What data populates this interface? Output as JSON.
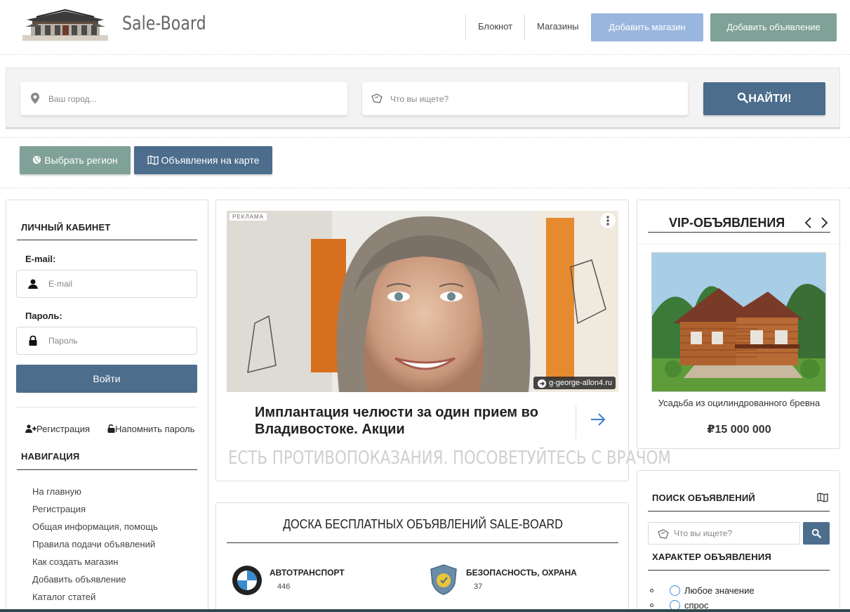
{
  "header": {
    "brand": "Sale-Board",
    "nav": [
      "Блокнот",
      "Магазины"
    ],
    "add_shop": "Добавить магазин",
    "add_ad": "Добавить объявление"
  },
  "search": {
    "city_placeholder": "Ваш город...",
    "query_placeholder": "Что вы ищете?",
    "find": "НАЙТИ!"
  },
  "subbar": {
    "region": "Выбрать регион",
    "map": "Объявления на карте"
  },
  "account": {
    "title": "ЛИЧНЫЙ КАБИНЕТ",
    "email_label": "E-mail:",
    "email_placeholder": "E-mail",
    "password_label": "Пароль:",
    "password_placeholder": "Пароль",
    "login": "Войти",
    "register": "Регистрация",
    "remind": "Напомнить пароль"
  },
  "navigation": {
    "title": "НАВИГАЦИЯ",
    "items": [
      "На главную",
      "Регистрация",
      "Общая информация, помощь",
      "Правила подачи объявлений",
      "Как создать магазин",
      "Добавить объявление",
      "Каталог статей"
    ]
  },
  "ad": {
    "tag": "РЕКЛАМА",
    "url": "g-george-allon4.ru",
    "title": "Имплантация челюсти за один прием во Владивостоке. Акции",
    "warning": "ЕСТЬ ПРОТИВОПОКАЗАНИЯ. ПОСОВЕТУЙТЕСЬ С ВРАЧОМ"
  },
  "board": {
    "title": "ДОСКА БЕСПЛАТНЫХ ОБЪЯВЛЕНИЙ SALE-BOARD",
    "categories": [
      {
        "name": "АВТОТРАНСПОРТ",
        "count": "446"
      },
      {
        "name": "БЕЗОПАСНОСТЬ, ОХРАНА",
        "count": "37"
      }
    ]
  },
  "vip": {
    "title": "VIP-ОБЪЯВЛЕНИЯ",
    "item_title": "Усадьба из оцилиндрованного бревна",
    "item_price": "₽15 000 000"
  },
  "ad_search": {
    "title": "ПОИСК ОБЪЯВЛЕНИЙ",
    "placeholder": "Что вы ищете?",
    "character_title": "ХАРАКТЕР ОБЪЯВЛЕНИЯ",
    "options": [
      "Любое значение",
      "спрос"
    ]
  },
  "colors": {
    "primary": "#4c6d8c",
    "accent_green": "#7fa197",
    "accent_light_blue": "#99b6de"
  }
}
